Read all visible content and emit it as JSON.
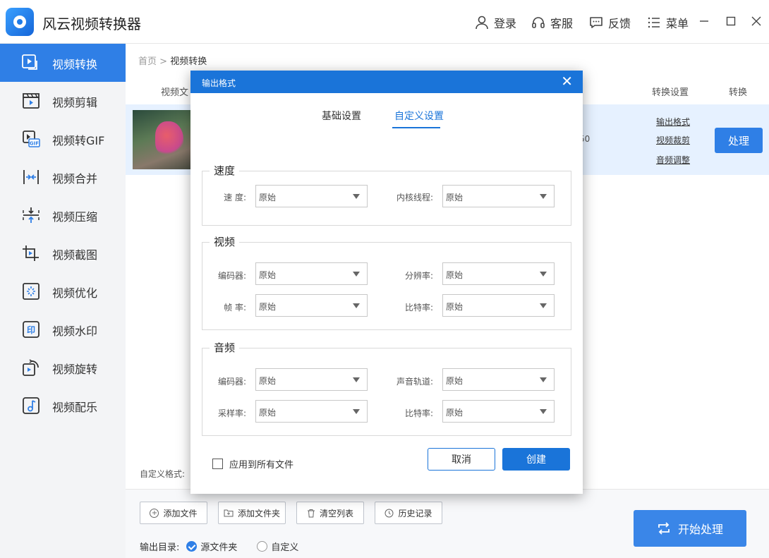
{
  "app": {
    "title": "风云视频转换器"
  },
  "titlebar": {
    "login": "登录",
    "service": "客服",
    "feedback": "反馈",
    "menu": "菜单"
  },
  "sidebar": {
    "items": [
      {
        "label": "视频转换",
        "icon": "video-convert-icon"
      },
      {
        "label": "视频剪辑",
        "icon": "clapperboard-icon"
      },
      {
        "label": "视频转GIF",
        "icon": "gif-icon"
      },
      {
        "label": "视频合并",
        "icon": "merge-icon"
      },
      {
        "label": "视频压缩",
        "icon": "compress-icon"
      },
      {
        "label": "视频截图",
        "icon": "crop-icon"
      },
      {
        "label": "视频优化",
        "icon": "sparkle-icon"
      },
      {
        "label": "视频水印",
        "icon": "watermark-icon"
      },
      {
        "label": "视频旋转",
        "icon": "rotate-icon"
      },
      {
        "label": "视频配乐",
        "icon": "music-icon"
      }
    ]
  },
  "breadcrumb": {
    "home": "首页",
    "separator": ">",
    "current": "视频转换"
  },
  "table": {
    "col_file": "视频文",
    "col_settings": "转换设置",
    "col_convert": "转换"
  },
  "file_row": {
    "size_fragment": "50",
    "links": [
      "输出格式",
      "视频裁剪",
      "音频调整"
    ],
    "process": "处理"
  },
  "custom_format_label": "自定义格式:",
  "bottom": {
    "add_file": "添加文件",
    "add_folder": "添加文件夹",
    "clear_list": "清空列表",
    "history": "历史记录",
    "output_dir_label": "输出目录:",
    "radio_source": "源文件夹",
    "radio_custom": "自定义",
    "start": "开始处理"
  },
  "dialog": {
    "title": "输出格式",
    "close": "✕",
    "tabs": [
      "基础设置",
      "自定义设置"
    ],
    "speed": {
      "title": "速度",
      "speed_label": "速  度:",
      "speed_value": "原始",
      "threads_label": "内核线程:",
      "threads_value": "原始"
    },
    "video": {
      "title": "视频",
      "encoder_label": "编码器:",
      "encoder_value": "原始",
      "resolution_label": "分辨率:",
      "resolution_value": "原始",
      "framerate_label": "帧  率:",
      "framerate_value": "原始",
      "bitrate_label": "比特率:",
      "bitrate_value": "原始"
    },
    "audio": {
      "title": "音频",
      "encoder_label": "编码器:",
      "encoder_value": "原始",
      "channel_label": "声音轨道:",
      "channel_value": "原始",
      "samplerate_label": "采样率:",
      "samplerate_value": "原始",
      "bitrate_label": "比特率:",
      "bitrate_value": "原始"
    },
    "apply_all": "应用到所有文件",
    "cancel": "取消",
    "create": "创建"
  }
}
